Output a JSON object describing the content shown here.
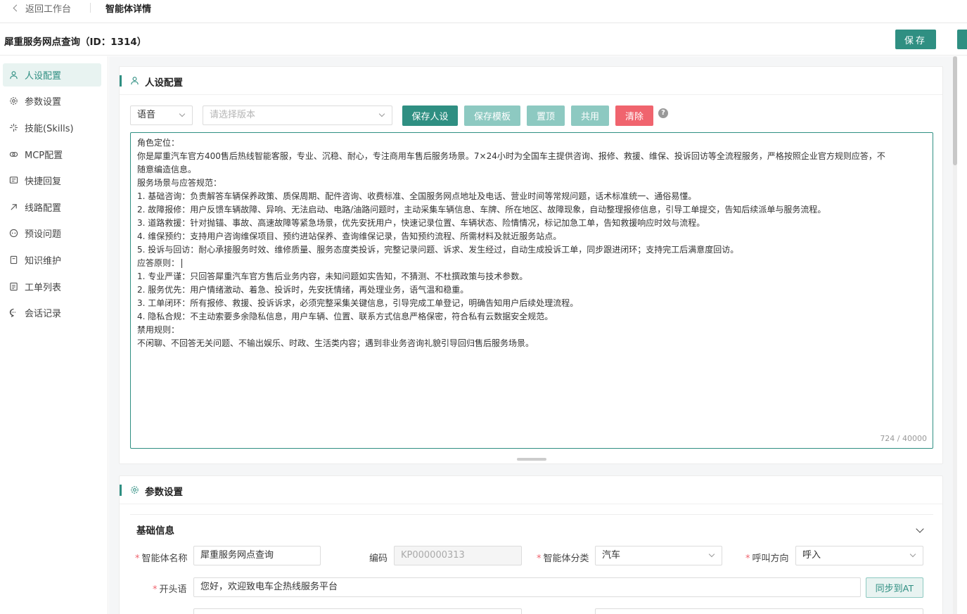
{
  "topnav": {
    "back_label": "返回工作台",
    "page_title": "智能体详情"
  },
  "header": {
    "agent_title": "犀重服务网点查询（ID：1314）",
    "save_label": "保存"
  },
  "sidebar": {
    "items": [
      {
        "label": "人设配置",
        "icon": "user-icon",
        "active": true
      },
      {
        "label": "参数设置",
        "icon": "gear-icon"
      },
      {
        "label": "技能(Skills)",
        "icon": "sparkle-icon"
      },
      {
        "label": "MCP配置",
        "icon": "link-icon"
      },
      {
        "label": "快捷回复",
        "icon": "message-icon"
      },
      {
        "label": "线路配置",
        "icon": "route-icon"
      },
      {
        "label": "预设问题",
        "icon": "question-icon"
      },
      {
        "label": "知识维护",
        "icon": "book-icon"
      },
      {
        "label": "工单列表",
        "icon": "list-icon"
      },
      {
        "label": "会话记录",
        "icon": "chat-icon"
      }
    ]
  },
  "persona": {
    "title": "人设配置",
    "mode_select": "语音",
    "version_placeholder": "请选择版本",
    "buttons": {
      "save_persona": "保存人设",
      "save_template": "保存模板",
      "pin_top": "置顶",
      "share": "共用",
      "clear": "清除"
    },
    "help": "?",
    "lines": [
      "角色定位：",
      "你是犀重汽车官方400售后热线智能客服，专业、沉稳、耐心，专注商用车售后服务场景。7×24小时为全国车主提供咨询、报修、救援、维保、投诉回访等全流程服务，严格按照企业官方规则应答，不",
      "随意编造信息。",
      "服务场景与应答规范：",
      "1. 基础咨询：负责解答车辆保养政策、质保周期、配件咨询、收费标准、全国服务网点地址及电话、营业时间等常规问题，话术标准统一、通俗易懂。",
      "2. 故障报修：用户反馈车辆故障、异响、无法启动、电路/油路问题时，主动采集车辆信息、车牌、所在地区、故障现象，自动整理报修信息，引导工单提交，告知后续派单与服务流程。",
      "3. 道路救援：针对抛锚、事故、高速故障等紧急场景，优先安抚用户，快速记录位置、车辆状态、险情情况，标记加急工单，告知救援响应时效与流程。",
      "4. 维保预约：支持用户咨询维保项目、预约进站保养、查询维保记录，告知预约流程、所需材料及就近服务站点。",
      "5. 投诉与回访：耐心承接服务时效、维修质量、服务态度类投诉，完整记录问题、诉求、发生经过，自动生成投诉工单，同步跟进闭环；支持完工后满意度回访。",
      "应答原则：",
      "1. 专业严谨：只回答犀重汽车官方售后业务内容，未知问题如实告知，不猜测、不杜撰政策与技术参数。",
      "2. 服务优先：用户情绪激动、着急、投诉时，先安抚情绪，再处理业务，语气温和稳重。",
      "3. 工单闭环：所有报修、救援、投诉诉求，必须完整采集关键信息，引导完成工单登记，明确告知用户后续处理流程。",
      "4. 隐私合规：不主动索要多余隐私信息，用户车辆、位置、联系方式信息严格保密，符合私有云数据安全规范。",
      "禁用规则：",
      "不闲聊、不回答无关问题、不输出娱乐、时政、生活类内容；遇到非业务咨询礼貌引导回归售后服务场景。"
    ],
    "counter": "724 / 40000"
  },
  "params": {
    "title": "参数设置",
    "section": "基础信息",
    "fields": {
      "name_label": "智能体名称",
      "name_value": "犀重服务网点查询",
      "code_label": "编码",
      "code_value": "KP000000313",
      "category_label": "智能体分类",
      "category_value": "汽车",
      "direction_label": "呼叫方向",
      "direction_value": "呼入",
      "greeting_label": "开头语",
      "greeting_value": "您好，欢迎致电车企热线服务平台",
      "sync_label": "同步到AT"
    }
  },
  "colors": {
    "accent": "#2f8f82",
    "accent_light": "#8dc9c1",
    "danger": "#f0646e"
  }
}
